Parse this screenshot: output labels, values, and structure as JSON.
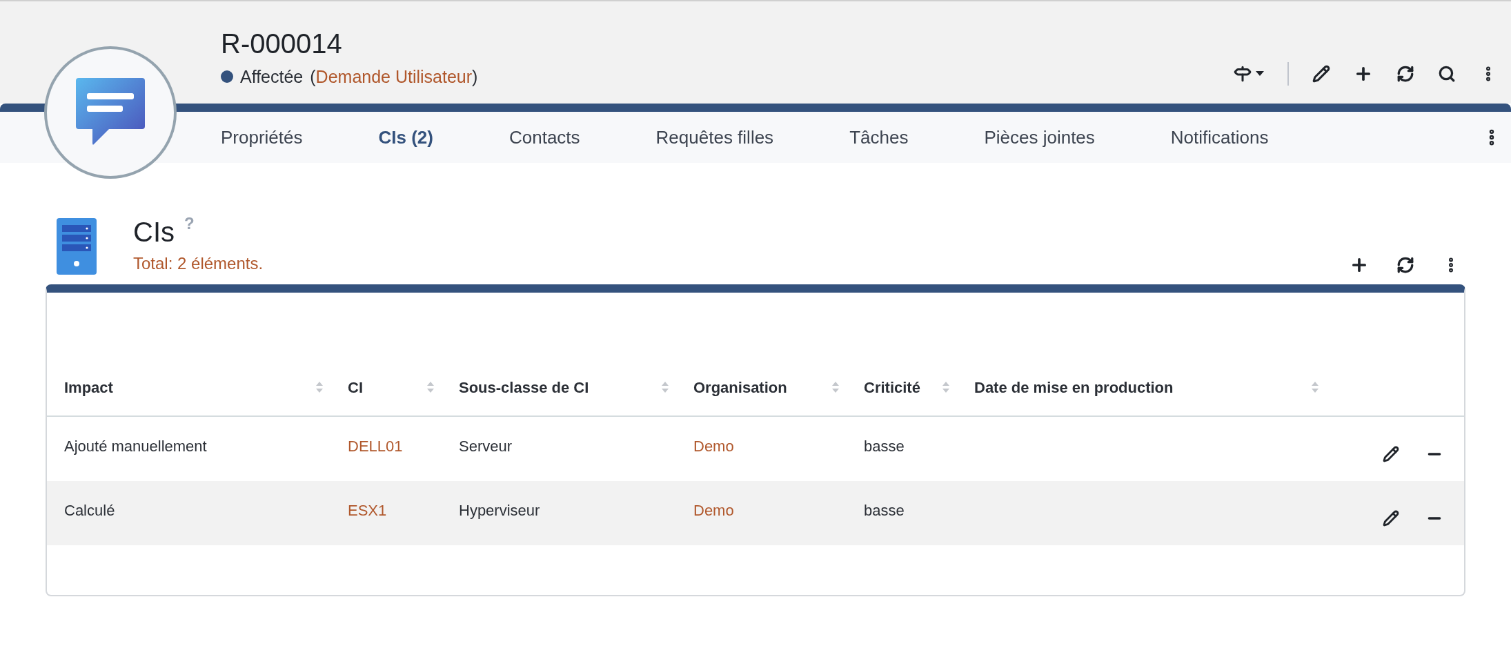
{
  "record": {
    "title": "R-000014",
    "status": {
      "label": "Affectée",
      "color": "#34527d"
    },
    "type_open": "(",
    "type": "Demande Utilisateur",
    "type_close": ")"
  },
  "tabs": [
    {
      "label": "Propriétés",
      "selected": false
    },
    {
      "label": "CIs (2)",
      "selected": true
    },
    {
      "label": "Contacts",
      "selected": false
    },
    {
      "label": "Requêtes filles",
      "selected": false
    },
    {
      "label": "Tâches",
      "selected": false
    },
    {
      "label": "Pièces jointes",
      "selected": false
    },
    {
      "label": "Notifications",
      "selected": false
    }
  ],
  "section": {
    "title": "CIs",
    "help": "?",
    "total": "Total: 2 éléments."
  },
  "table": {
    "columns": [
      {
        "label": "Impact",
        "kind": "text"
      },
      {
        "label": "CI",
        "kind": "link"
      },
      {
        "label": "Sous-classe de CI",
        "kind": "text"
      },
      {
        "label": "Organisation",
        "kind": "link"
      },
      {
        "label": "Criticité",
        "kind": "text"
      },
      {
        "label": "Date de mise en production",
        "kind": "text"
      }
    ],
    "rows": [
      {
        "highlighted": false,
        "cells": [
          "Ajouté manuellement",
          "DELL01",
          "Serveur",
          "Demo",
          "basse",
          ""
        ]
      },
      {
        "highlighted": true,
        "cells": [
          "Calculé",
          "ESX1",
          "Hyperviseur",
          "Demo",
          "basse",
          ""
        ]
      }
    ]
  }
}
